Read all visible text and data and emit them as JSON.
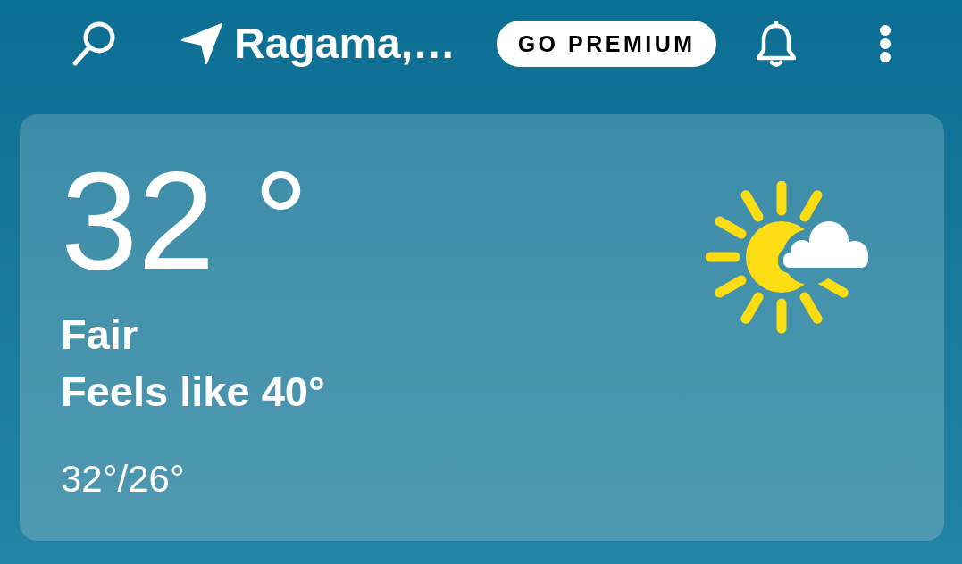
{
  "top_bar": {
    "location": "Ragama,…",
    "premium_button": "GO PREMIUM"
  },
  "current_conditions": {
    "temperature": "32 °",
    "condition": "Fair",
    "feels_like": "Feels like 40°",
    "high_low": "32°/26°"
  }
}
